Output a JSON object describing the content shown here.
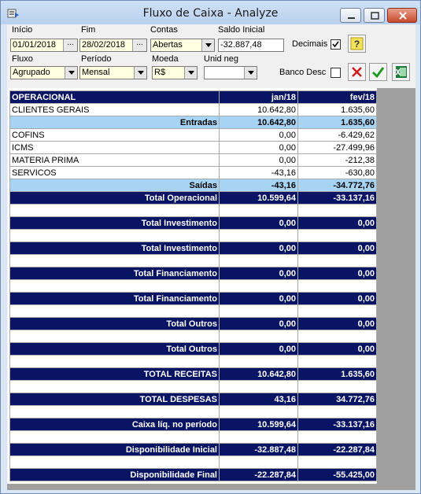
{
  "window": {
    "title": "Fluxo de Caixa - Analyze"
  },
  "filters": {
    "inicio_label": "Início",
    "inicio_value": "01/01/2018",
    "fim_label": "Fim",
    "fim_value": "28/02/2018",
    "contas_label": "Contas",
    "contas_value": "Abertas",
    "saldo_label": "Saldo Inicial",
    "saldo_value": "-32.887,48",
    "decimais_label": "Decimais",
    "decimais_checked": true,
    "fluxo_label": "Fluxo",
    "fluxo_value": "Agrupado",
    "periodo_label": "Período",
    "periodo_value": "Mensal",
    "moeda_label": "Moeda",
    "moeda_value": "R$",
    "unid_label": "Unid neg",
    "unid_value": "",
    "banco_label": "Banco Desc",
    "banco_checked": false,
    "help_label": "?"
  },
  "grid": {
    "header": {
      "title": "OPERACIONAL",
      "col1": "jan/18",
      "col2": "fev/18"
    },
    "rows": [
      {
        "type": "dat",
        "label": "CLIENTES GERAIS",
        "v1": "10.642,80",
        "v2": "1.635,60"
      },
      {
        "type": "sub",
        "label": "Entradas",
        "v1": "10.642,80",
        "v2": "1.635,60"
      },
      {
        "type": "dat",
        "label": "COFINS",
        "v1": "0,00",
        "v2": "-6.429,62"
      },
      {
        "type": "dat",
        "label": "ICMS",
        "v1": "0,00",
        "v2": "-27.499,96"
      },
      {
        "type": "dat",
        "label": "MATERIA PRIMA",
        "v1": "0,00",
        "v2": "-212,38"
      },
      {
        "type": "dat",
        "label": "SERVICOS",
        "v1": "-43,16",
        "v2": "-630,80"
      },
      {
        "type": "sub",
        "label": "Saídas",
        "v1": "-43,16",
        "v2": "-34.772,76"
      },
      {
        "type": "tot",
        "label": "Total Operacional",
        "v1": "10.599,64",
        "v2": "-33.137,16"
      },
      {
        "type": "blank"
      },
      {
        "type": "tot",
        "label": "Total Investimento",
        "v1": "0,00",
        "v2": "0,00"
      },
      {
        "type": "blank"
      },
      {
        "type": "tot",
        "label": "Total Investimento",
        "v1": "0,00",
        "v2": "0,00"
      },
      {
        "type": "blank"
      },
      {
        "type": "tot",
        "label": "Total Financiamento",
        "v1": "0,00",
        "v2": "0,00"
      },
      {
        "type": "blank"
      },
      {
        "type": "tot",
        "label": "Total Financiamento",
        "v1": "0,00",
        "v2": "0,00"
      },
      {
        "type": "blank"
      },
      {
        "type": "tot",
        "label": "Total Outros",
        "v1": "0,00",
        "v2": "0,00"
      },
      {
        "type": "blank"
      },
      {
        "type": "tot",
        "label": "Total Outros",
        "v1": "0,00",
        "v2": "0,00"
      },
      {
        "type": "blank"
      },
      {
        "type": "tot",
        "label": "TOTAL RECEITAS",
        "v1": "10.642,80",
        "v2": "1.635,60"
      },
      {
        "type": "blank"
      },
      {
        "type": "tot",
        "label": "TOTAL DESPESAS",
        "v1": "43,16",
        "v2": "34.772,76"
      },
      {
        "type": "blank"
      },
      {
        "type": "tot",
        "label": "Caixa líq. no período",
        "v1": "10.599,64",
        "v2": "-33.137,16"
      },
      {
        "type": "blank"
      },
      {
        "type": "tot",
        "label": "Disponibilidade Inicial",
        "v1": "-32.887,48",
        "v2": "-22.287,84"
      },
      {
        "type": "blank"
      },
      {
        "type": "tot",
        "label": "Disponibilidade Final",
        "v1": "-22.287,84",
        "v2": "-55.425,00"
      }
    ]
  },
  "colors": {
    "header": "#0a1464",
    "subtotal": "#a8d4f4"
  }
}
